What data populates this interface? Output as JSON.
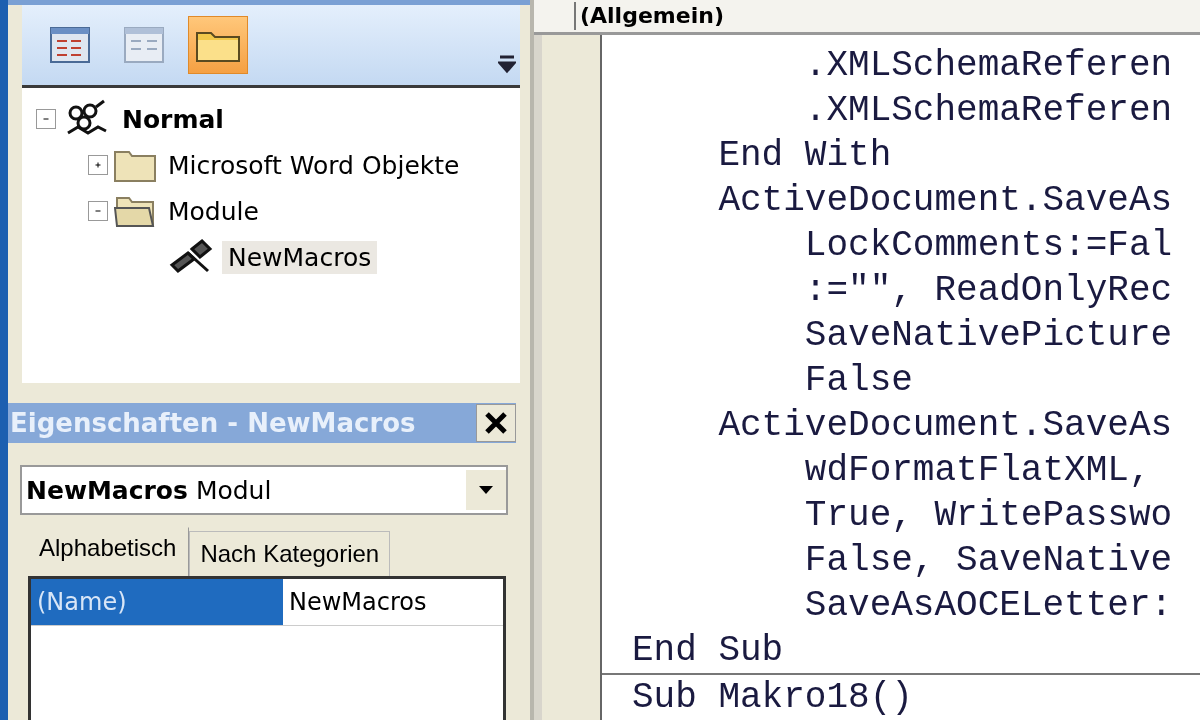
{
  "project_explorer": {
    "toolbar": [
      {
        "kind": "code",
        "selected": false
      },
      {
        "kind": "object",
        "selected": false
      },
      {
        "kind": "folders",
        "selected": true
      }
    ],
    "tree": [
      {
        "label": "Normal",
        "kind": "project",
        "expanded": true,
        "selected": false,
        "children": [
          {
            "label": "Microsoft Word Objekte",
            "kind": "folder",
            "expanded": false,
            "selected": false
          },
          {
            "label": "Module",
            "kind": "folder-open",
            "expanded": true,
            "selected": false,
            "children": [
              {
                "label": "NewMacros",
                "kind": "module",
                "selected": true
              }
            ]
          }
        ]
      }
    ]
  },
  "properties": {
    "title": "Eigenschaften - NewMacros",
    "object_select": "**NewMacros** Modul",
    "tabs": [
      {
        "label": "Alphabetisch",
        "selected": true
      },
      {
        "label": "Nach Kategorien",
        "selected": false
      }
    ],
    "rows": [
      {
        "name": "(Name)",
        "value": "NewMacros",
        "selected": true
      }
    ]
  },
  "code_window": {
    "object_select": "(Allgemein)",
    "lines": [
      "        .XMLSchemaReferen",
      "        .XMLSchemaReferen",
      "    End With",
      "    ActiveDocument.SaveAs",
      "        LockComments:=Fal",
      "        :=\"\", ReadOnlyRec",
      "        SaveNativePicture",
      "        False",
      "    ActiveDocument.SaveAs",
      "        wdFormatFlatXML,",
      "        True, WritePasswo",
      "        False, SaveNative",
      "        SaveAsAOCELetter:",
      "End Sub"
    ],
    "next_procedure": [
      "Sub Makro18()"
    ]
  }
}
